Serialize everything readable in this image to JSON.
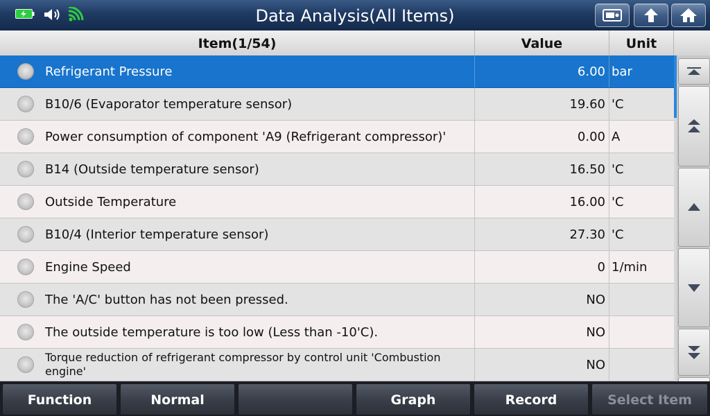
{
  "header": {
    "title": "Data Analysis(All Items)",
    "icons": [
      "battery-charging-icon",
      "speaker-icon",
      "wifi-icon"
    ],
    "buttons": [
      "screenshot-icon",
      "back-arrow-icon",
      "home-icon"
    ]
  },
  "table": {
    "columns": {
      "item": "Item(1/54)",
      "value": "Value",
      "unit": "Unit"
    },
    "rows": [
      {
        "name": "Refrigerant Pressure",
        "value": "6.00",
        "unit": "bar",
        "selected": true
      },
      {
        "name": "B10/6 (Evaporator temperature sensor)",
        "value": "19.60",
        "unit": "'C"
      },
      {
        "name": "Power consumption of component 'A9 (Refrigerant compressor)'",
        "value": "0.00",
        "unit": "A"
      },
      {
        "name": "B14 (Outside temperature sensor)",
        "value": "16.50",
        "unit": "'C"
      },
      {
        "name": "Outside Temperature",
        "value": "16.00",
        "unit": "'C"
      },
      {
        "name": "B10/4 (Interior temperature sensor)",
        "value": "27.30",
        "unit": "'C"
      },
      {
        "name": "Engine Speed",
        "value": "0",
        "unit": "1/min"
      },
      {
        "name": "The 'A/C' button has not been pressed.",
        "value": "NO",
        "unit": ""
      },
      {
        "name": "The outside temperature is too low (Less than -10'C).",
        "value": "NO",
        "unit": ""
      },
      {
        "name": "Torque reduction of refrigerant compressor by control unit 'Combustion engine'",
        "value": "NO",
        "unit": ""
      }
    ]
  },
  "scroll": {
    "buttons": [
      "scroll-to-top-icon",
      "page-up-icon",
      "line-up-icon",
      "line-down-icon",
      "page-down-icon",
      "scroll-to-bottom-icon"
    ]
  },
  "footer": {
    "buttons": [
      {
        "label": "Function",
        "enabled": true
      },
      {
        "label": "Normal",
        "enabled": true
      },
      {
        "label": "",
        "enabled": true
      },
      {
        "label": "Graph",
        "enabled": true
      },
      {
        "label": "Record",
        "enabled": true
      },
      {
        "label": "Select Item",
        "enabled": false
      }
    ]
  },
  "colors": {
    "header_bg": "#1f3a62",
    "selected_row": "#1874cc",
    "status_green": "#2ecc40"
  }
}
